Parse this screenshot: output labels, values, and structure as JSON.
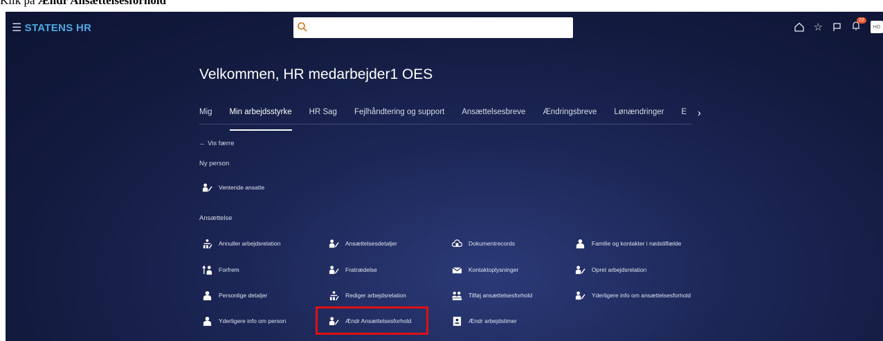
{
  "caption": {
    "prefix": "Klik på ",
    "bold": "Ændr Ansættelsesforhold"
  },
  "header": {
    "brand": "STATENS HR",
    "notif_count": "22",
    "avatar": "HO"
  },
  "icons": {
    "menu": "hamburger-icon",
    "search": "search-icon",
    "home": "home-icon",
    "favorite": "star-icon",
    "flag": "flag-icon",
    "bell": "bell-icon"
  },
  "colors": {
    "brand": "#4fa8e0",
    "background": "#121a3e",
    "highlight": "#e01010",
    "badge": "#e8542c"
  },
  "welcome": "Velkommen, HR medarbejder1 OES",
  "tabs": [
    "Mig",
    "Min arbejdsstyrke",
    "HR Sag",
    "Fejlhåndtering og support",
    "Ansættelsesbreve",
    "Ændringsbreve",
    "Lønændringer",
    "E"
  ],
  "active_tab": "Min arbejdsstyrke",
  "vis_faerre": "← Vis færre",
  "sections": {
    "ny_person": "Ny person",
    "ansaettelse": "Ansættelse"
  },
  "ny_person_items": [
    "Ventende ansatte"
  ],
  "ansaettelse_items": [
    [
      "Annuller arbejdsrelation",
      "Ansættelsesdetaljer",
      "Dokumentrecords",
      "Familie og kontakter i nødstilfælde"
    ],
    [
      "Forfrem",
      "Fratrædelse",
      "Kontaktoplysninger",
      "Opret arbejdsrelation"
    ],
    [
      "Personlige detaljer",
      "Rediger arbejdsrelation",
      "Tilføj ansættelsesforhold",
      "Yderligere info om ansættelsesforhold"
    ],
    [
      "Yderligere info om person",
      "Ændr Ansættelsesforhold",
      "Ændr arbejdstimer",
      ""
    ]
  ]
}
